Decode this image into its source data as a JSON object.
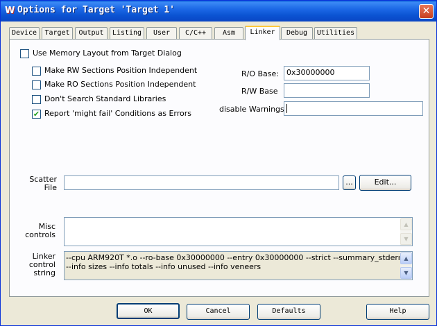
{
  "window": {
    "title": "Options for Target 'Target 1'",
    "app_icon": "keil-icon"
  },
  "tabs": [
    {
      "label": "Device"
    },
    {
      "label": "Target"
    },
    {
      "label": "Output"
    },
    {
      "label": "Listing"
    },
    {
      "label": "User"
    },
    {
      "label": "C/C++"
    },
    {
      "label": "Asm"
    },
    {
      "label": "Linker",
      "active": true
    },
    {
      "label": "Debug"
    },
    {
      "label": "Utilities"
    }
  ],
  "options": {
    "use_memory_layout": {
      "label": "Use Memory Layout from Target Dialog",
      "checked": false
    },
    "rw_independent": {
      "label": "Make RW Sections Position Independent",
      "checked": false
    },
    "ro_independent": {
      "label": "Make RO Sections Position Independent",
      "checked": false
    },
    "dont_search_libs": {
      "label": "Don't Search Standard Libraries",
      "checked": false
    },
    "might_fail_errors": {
      "label": "Report 'might fail' Conditions as Errors",
      "checked": true
    }
  },
  "fields": {
    "ro_base": {
      "label": "R/O Base:",
      "value": "0x30000000"
    },
    "rw_base": {
      "label": "R/W Base",
      "value": ""
    },
    "disable_warnings": {
      "label": "disable Warnings:",
      "value": ""
    }
  },
  "scatter": {
    "label_line1": "Scatter",
    "label_line2": "File",
    "value": "",
    "browse_label": "...",
    "edit_label": "Edit..."
  },
  "misc": {
    "label_line1": "Misc",
    "label_line2": "controls",
    "value": ""
  },
  "linker": {
    "label_line1": "Linker",
    "label_line2": "control",
    "label_line3": "string",
    "line1": "--cpu ARM920T *.o --ro-base 0x30000000 --entry 0x30000000 --strict --summary_stderr --info summarysi",
    "line2": "--info sizes --info totals --info unused --info veneers"
  },
  "buttons": {
    "ok": "OK",
    "cancel": "Cancel",
    "defaults": "Defaults",
    "help": "Help"
  }
}
